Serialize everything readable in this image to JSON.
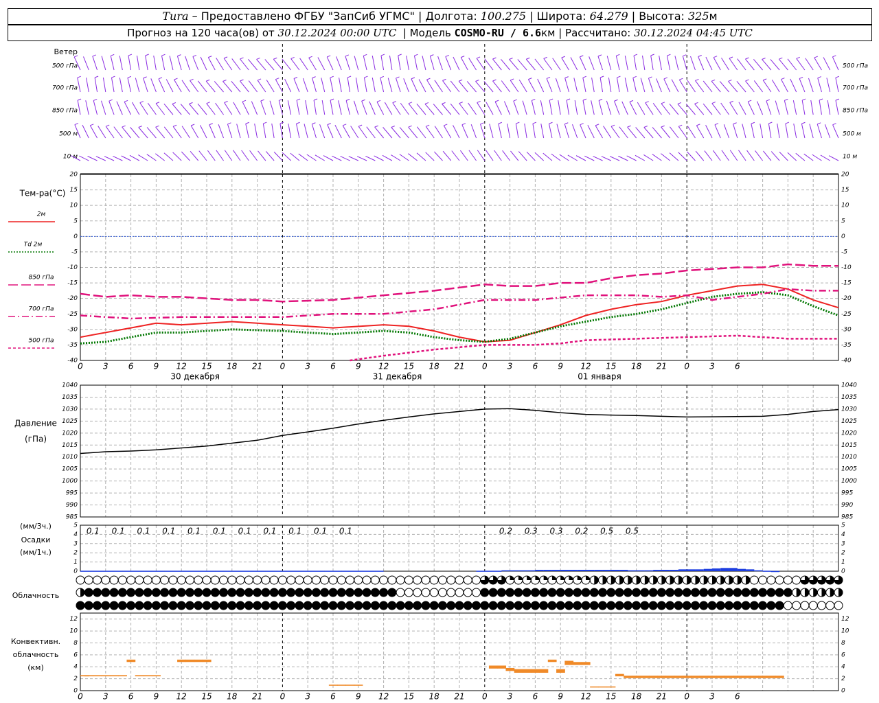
{
  "header": {
    "station": "Tura",
    "dash": "–",
    "provider": "Предоставлено ФГБУ \"ЗапСиб УГМС\"",
    "lon_label": "Долгота:",
    "lon_value": "100.275",
    "lat_label": "Широта:",
    "lat_value": "64.279",
    "alt_label": "Высота:",
    "alt_value": "325",
    "alt_unit": "м",
    "forecast_label": "Прогноз на 120 часа(ов) от",
    "forecast_from": "30.12.2024 00:00 UTC",
    "model_label": "Модель",
    "model_name": "COSMO-RU / 6.6",
    "model_unit": "км",
    "calc_label": "Рассчитано:",
    "calc_time": "30.12.2024 04:45 UTC"
  },
  "panels": {
    "wind": {
      "title": "Ветер",
      "levels": [
        "500 гПа",
        "700 гПа",
        "850 гПа",
        "500 м",
        "10  м"
      ],
      "color": "#8a2be2"
    },
    "temperature": {
      "title": "Тем-ра(°C)",
      "legend": [
        {
          "label": "2м",
          "color": "#ee2222",
          "dash": "solid"
        },
        {
          "label": "Td  2м",
          "color": "#007700",
          "dash": "dotted"
        },
        {
          "label": "850 гПа",
          "color": "#e0127c",
          "dash": "longdash"
        },
        {
          "label": "700 гПа",
          "color": "#e0127c",
          "dash": "dashdot"
        },
        {
          "label": "500 гПа",
          "color": "#e0127c",
          "dash": "dash"
        }
      ],
      "y_ticks": [
        "20",
        "15",
        "10",
        "5",
        "0",
        "-5",
        "-10",
        "-15",
        "-20",
        "-25",
        "-30",
        "-35",
        "-40"
      ],
      "x_ticks": [
        "0",
        "3",
        "6",
        "9",
        "12",
        "15",
        "18",
        "21",
        "0",
        "3",
        "6",
        "9",
        "12",
        "15",
        "18",
        "21",
        "0",
        "3",
        "6",
        "9",
        "12",
        "15",
        "18",
        "21",
        "0",
        "3",
        "6"
      ],
      "dates": [
        "30 декабря",
        "31 декабря",
        "01 января"
      ]
    },
    "pressure": {
      "title": "Давление",
      "unit": "(гПа)",
      "y_ticks": [
        "1040",
        "1035",
        "1030",
        "1025",
        "1020",
        "1015",
        "1010",
        "1005",
        "1000",
        "995",
        "990",
        "985"
      ]
    },
    "precip": {
      "title_left": "(мм/3ч.)",
      "title": "Осадки",
      "unit": "(мм/1ч.)",
      "y_ticks": [
        "5",
        "4",
        "3",
        "2",
        "1",
        "0"
      ],
      "labels_3h": [
        "0.1",
        "0.1",
        "0.1",
        "0.1",
        "0.1",
        "0.1",
        "0.1",
        "0.1",
        "0.1",
        "0.1",
        "0.1",
        "0.2",
        "0.3",
        "0.3",
        "0.2",
        "0.5",
        "0.5"
      ]
    },
    "cloud": {
      "title": "Облачность"
    },
    "conv": {
      "title": [
        "Конвективн.",
        "облачность",
        "(км)"
      ],
      "y_ticks": [
        "12",
        "10",
        "8",
        "6",
        "4",
        "2",
        "0"
      ],
      "x_ticks": [
        "0",
        "3",
        "6",
        "9",
        "12",
        "15",
        "18",
        "21",
        "0",
        "3",
        "6",
        "9",
        "12",
        "15",
        "18",
        "21",
        "0",
        "3",
        "6",
        "9",
        "12",
        "15",
        "18",
        "21",
        "0",
        "3",
        "6"
      ]
    }
  },
  "chart_data": [
    {
      "type": "line",
      "title": "Тем-ра(°C)",
      "x_unit": "hours since 30.12.2024 00:00 UTC",
      "ylim": [
        -40,
        20
      ],
      "series": [
        {
          "name": "2м",
          "x": [
            0,
            6,
            9,
            12,
            18,
            21,
            24,
            27,
            30,
            36,
            39,
            42,
            45,
            48,
            51,
            54,
            57,
            60,
            63,
            66,
            69,
            72,
            75,
            78,
            81,
            84,
            87,
            90
          ],
          "values": [
            -32.5,
            -29.5,
            -28,
            -28.5,
            -27.5,
            -28,
            -28.5,
            -29,
            -29.5,
            -28.5,
            -29,
            -30.5,
            -32.5,
            -34,
            -33.5,
            -31,
            -28.5,
            -25.5,
            -23.5,
            -22,
            -21,
            -19,
            -17.5,
            -16,
            -15.5,
            -17,
            -20.5,
            -23
          ]
        },
        {
          "name": "Td  2м",
          "x": [
            0,
            3,
            6,
            9,
            12,
            18,
            24,
            27,
            30,
            36,
            39,
            42,
            45,
            48,
            51,
            54,
            57,
            60,
            63,
            66,
            69,
            72,
            75,
            78,
            81,
            84,
            87,
            90
          ],
          "values": [
            -34.5,
            -34,
            -32.5,
            -31,
            -31,
            -30,
            -30.5,
            -31,
            -31.5,
            -30.5,
            -31,
            -32.5,
            -33.5,
            -34,
            -33,
            -31,
            -29,
            -27.5,
            -26,
            -25,
            -23.5,
            -21.5,
            -19.5,
            -18.5,
            -18,
            -19,
            -22.5,
            -25.5
          ]
        },
        {
          "name": "850 гПа",
          "x": [
            0,
            3,
            6,
            9,
            12,
            18,
            21,
            24,
            30,
            36,
            42,
            48,
            51,
            54,
            57,
            60,
            63,
            66,
            69,
            72,
            75,
            78,
            81,
            84,
            87,
            90
          ],
          "values": [
            -18.5,
            -19.5,
            -19,
            -19.5,
            -19.5,
            -20.5,
            -20.5,
            -21,
            -20.5,
            -19,
            -17.5,
            -15.5,
            -16,
            -16,
            -15,
            -15,
            -13.5,
            -12.5,
            -12,
            -11,
            -10.5,
            -10,
            -10,
            -9,
            -9.5,
            -9.5
          ]
        },
        {
          "name": "700 гПа",
          "x": [
            0,
            6,
            12,
            18,
            24,
            30,
            36,
            42,
            48,
            54,
            60,
            66,
            69,
            72,
            75,
            78,
            81,
            84,
            87,
            90
          ],
          "values": [
            -25.5,
            -26.5,
            -26,
            -26,
            -26,
            -25,
            -25,
            -23.5,
            -20.5,
            -20.5,
            -19,
            -19,
            -19.5,
            -19,
            -20.5,
            -19.5,
            -18.5,
            -17,
            -17.5,
            -17.5
          ]
        },
        {
          "name": "500 гПа",
          "x": [
            32,
            36,
            42,
            48,
            54,
            57,
            60,
            66,
            72,
            78,
            81,
            84,
            87,
            90
          ],
          "values": [
            -40,
            -38.5,
            -36.5,
            -35,
            -35,
            -34.5,
            -33.5,
            -33,
            -32.5,
            -32,
            -32.5,
            -33,
            -33,
            -33
          ]
        }
      ]
    },
    {
      "type": "line",
      "title": "Давление",
      "ylim": [
        985,
        1040
      ],
      "series": [
        {
          "name": "Давление",
          "x": [
            0,
            3,
            6,
            9,
            12,
            15,
            18,
            21,
            24,
            27,
            30,
            33,
            36,
            39,
            42,
            45,
            48,
            51,
            54,
            57,
            60,
            63,
            66,
            69,
            72,
            75,
            78,
            81,
            84,
            87,
            90
          ],
          "values": [
            1011.5,
            1012.2,
            1012.5,
            1013,
            1013.8,
            1014.6,
            1015.8,
            1017,
            1019,
            1020.5,
            1022,
            1023.8,
            1025.3,
            1026.7,
            1028,
            1029,
            1030,
            1030.2,
            1029.5,
            1028.5,
            1027.8,
            1027.5,
            1027.3,
            1027,
            1026.7,
            1026.8,
            1026.9,
            1027,
            1027.8,
            1029,
            1029.8
          ]
        }
      ]
    },
    {
      "type": "bar",
      "title": "Осадки",
      "ylim": [
        0,
        5
      ],
      "series": [
        {
          "name": "мм/1ч.",
          "x": [
            1,
            2,
            3,
            4,
            5,
            6,
            7,
            8,
            9,
            10,
            11,
            12,
            13,
            14,
            15,
            16,
            17,
            18,
            19,
            20,
            21,
            22,
            23,
            24,
            25,
            26,
            27,
            28,
            29,
            30,
            31,
            32,
            33,
            34,
            35,
            36,
            48,
            49,
            50,
            51,
            52,
            53,
            54,
            55,
            56,
            57,
            58,
            59,
            60,
            61,
            62,
            63,
            64,
            65,
            66,
            67,
            68,
            69,
            70,
            71,
            72,
            73,
            74,
            75,
            76,
            77,
            78,
            79,
            80,
            81,
            82,
            83
          ],
          "values": [
            0.05,
            0.05,
            0.05,
            0.05,
            0.05,
            0.05,
            0.05,
            0.05,
            0.05,
            0.05,
            0.05,
            0.05,
            0.05,
            0.05,
            0.05,
            0.05,
            0.05,
            0.05,
            0.05,
            0.05,
            0.05,
            0.05,
            0.05,
            0.05,
            0.05,
            0.05,
            0.05,
            0.05,
            0.05,
            0.05,
            0.05,
            0.05,
            0.05,
            0.05,
            0.05,
            0.05,
            0.05,
            0.05,
            0.05,
            0.1,
            0.1,
            0.1,
            0.1,
            0.15,
            0.15,
            0.15,
            0.15,
            0.15,
            0.15,
            0.15,
            0.15,
            0.15,
            0.15,
            0.15,
            0.1,
            0.1,
            0.1,
            0.15,
            0.15,
            0.15,
            0.2,
            0.2,
            0.2,
            0.25,
            0.3,
            0.35,
            0.35,
            0.25,
            0.2,
            0.1,
            0.05,
            0.02
          ]
        }
      ]
    },
    {
      "type": "bar",
      "title": "Конвективн. облачность",
      "ylim": [
        0,
        13
      ],
      "series": [
        {
          "name": "ranges_km",
          "x": [
            0.5,
            1,
            2,
            3,
            4,
            5,
            6,
            7,
            8,
            9,
            12,
            13,
            14,
            15,
            30,
            31,
            32,
            33,
            49,
            50,
            51,
            52,
            53,
            54,
            55,
            56,
            57,
            58,
            59,
            60,
            61,
            62,
            63,
            64,
            65,
            66,
            67,
            68,
            69,
            70,
            71,
            72,
            73,
            74,
            75,
            76,
            77,
            78,
            79,
            80,
            81,
            82,
            83
          ],
          "values": [
            [
              2.4,
              2.6
            ],
            [
              2.4,
              2.6
            ],
            [
              2.4,
              2.6
            ],
            [
              2.4,
              2.6
            ],
            [
              2.4,
              2.6
            ],
            [
              2.4,
              2.6
            ],
            [
              4.8,
              5.2
            ],
            [
              2.4,
              2.6
            ],
            [
              2.4,
              2.6
            ],
            [
              2.4,
              2.6
            ],
            [
              4.8,
              5.2
            ],
            [
              4.8,
              5.2
            ],
            [
              4.8,
              5.2
            ],
            [
              4.8,
              5.2
            ],
            [
              0.9,
              1.0
            ],
            [
              0.9,
              1.0
            ],
            [
              0.9,
              1.0
            ],
            [
              0.9,
              1.0
            ],
            [
              3.7,
              4.2
            ],
            [
              3.7,
              4.2
            ],
            [
              3.3,
              3.8
            ],
            [
              3.0,
              3.6
            ],
            [
              3.0,
              3.6
            ],
            [
              3.0,
              3.6
            ],
            [
              3.0,
              3.6
            ],
            [
              4.8,
              5.2
            ],
            [
              3.0,
              3.6
            ],
            [
              4.3,
              5.0
            ],
            [
              4.3,
              4.8
            ],
            [
              4.3,
              4.8
            ],
            [
              0.6,
              0.7
            ],
            [
              0.6,
              0.7
            ],
            [
              0.6,
              0.7
            ],
            [
              2.4,
              2.8
            ],
            [
              2.1,
              2.5
            ],
            [
              2.1,
              2.5
            ],
            [
              2.1,
              2.5
            ],
            [
              2.1,
              2.5
            ],
            [
              2.1,
              2.5
            ],
            [
              2.1,
              2.5
            ],
            [
              2.1,
              2.5
            ],
            [
              2.1,
              2.5
            ],
            [
              2.1,
              2.5
            ],
            [
              2.1,
              2.5
            ],
            [
              2.1,
              2.5
            ],
            [
              2.1,
              2.5
            ],
            [
              2.1,
              2.5
            ],
            [
              2.1,
              2.5
            ],
            [
              2.1,
              2.5
            ],
            [
              2.1,
              2.5
            ],
            [
              2.1,
              2.5
            ],
            [
              2.1,
              2.5
            ],
            [
              2.1,
              2.5
            ]
          ]
        }
      ]
    }
  ]
}
